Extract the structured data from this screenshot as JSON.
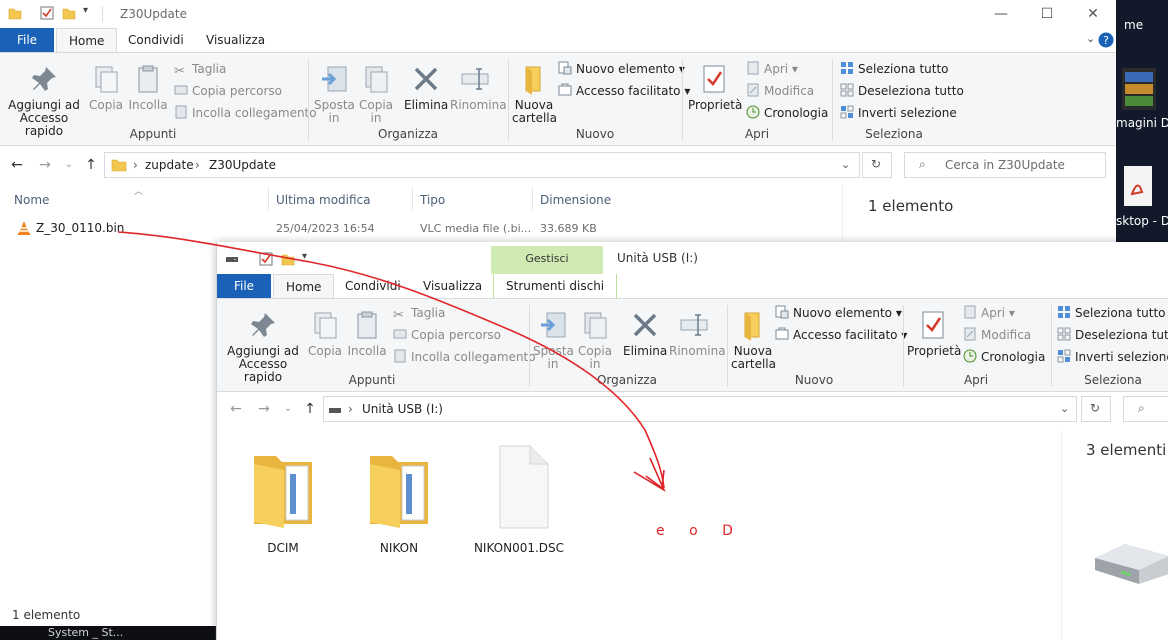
{
  "desktop": {
    "items": [
      {
        "label": "me"
      },
      {
        "label": "magini D"
      },
      {
        "label": "sktop - D"
      }
    ],
    "taskbar_text": "System _ St..."
  },
  "back_window": {
    "title": "Z30Update",
    "tabs": [
      {
        "label": "File"
      },
      {
        "label": "Home"
      },
      {
        "label": "Condividi"
      },
      {
        "label": "Visualizza"
      }
    ],
    "ribbon": {
      "appunti": {
        "pin_label": "Aggiungi ad Accesso rapido",
        "copy_label": "Copia",
        "paste_label": "Incolla",
        "cut_label": "Taglia",
        "copy_path_label": "Copia percorso",
        "paste_link_label": "Incolla collegamento",
        "group_label": "Appunti"
      },
      "organizza": {
        "move_label": "Sposta in",
        "copyto_label": "Copia in",
        "delete_label": "Elimina",
        "rename_label": "Rinomina",
        "group_label": "Organizza"
      },
      "nuovo": {
        "new_folder_label": "Nuova cartella",
        "new_item_label": "Nuovo elemento",
        "easy_access_label": "Accesso facilitato",
        "group_label": "Nuovo"
      },
      "apri": {
        "properties_label": "Proprietà",
        "open_label": "Apri",
        "edit_label": "Modifica",
        "history_label": "Cronologia",
        "group_label": "Apri"
      },
      "seleziona": {
        "select_all_label": "Seleziona tutto",
        "select_none_label": "Deseleziona tutto",
        "invert_label": "Inverti selezione",
        "group_label": "Seleziona"
      }
    },
    "address": {
      "crumbs": [
        "zupdate",
        "Z30Update"
      ],
      "search_placeholder": "Cerca in Z30Update"
    },
    "columns": {
      "name": "Nome",
      "modified": "Ultima modifica",
      "type": "Tipo",
      "size": "Dimensione"
    },
    "files": [
      {
        "name": "Z_30_0110.bin",
        "modified": "25/04/2023 16:54",
        "type": "VLC media file (.bi...",
        "size": "33.689 KB"
      }
    ],
    "details_count": "1 elemento",
    "status": "1 elemento"
  },
  "front_window": {
    "title": "Unità USB (I:)",
    "context_tab_group": "Gestisci",
    "tabs": [
      {
        "label": "File"
      },
      {
        "label": "Home"
      },
      {
        "label": "Condividi"
      },
      {
        "label": "Visualizza"
      },
      {
        "label": "Strumenti dischi"
      }
    ],
    "ribbon": {
      "appunti": {
        "pin_label": "Aggiungi ad Accesso rapido",
        "copy_label": "Copia",
        "paste_label": "Incolla",
        "cut_label": "Taglia",
        "copy_path_label": "Copia percorso",
        "paste_link_label": "Incolla collegamento",
        "group_label": "Appunti"
      },
      "organizza": {
        "move_label": "Sposta in",
        "copyto_label": "Copia in",
        "delete_label": "Elimina",
        "rename_label": "Rinomina",
        "group_label": "Organizza"
      },
      "nuovo": {
        "new_folder_label": "Nuova cartella",
        "new_item_label": "Nuovo elemento",
        "easy_access_label": "Accesso facilitato",
        "group_label": "Nuovo"
      },
      "apri": {
        "properties_label": "Proprietà",
        "open_label": "Apri",
        "edit_label": "Modifica",
        "history_label": "Cronologia",
        "group_label": "Apri"
      },
      "seleziona": {
        "select_all_label": "Seleziona tutto",
        "select_none_label": "Deseleziona tutto",
        "invert_label": "Inverti selezione",
        "group_label": "Seleziona"
      }
    },
    "address": {
      "crumbs": [
        "Unità USB (I:)"
      ]
    },
    "items": [
      {
        "name": "DCIM"
      },
      {
        "name": "NIKON"
      },
      {
        "name": "NIKON001.DSC"
      }
    ],
    "details_count": "3 elementi"
  },
  "annotation": {
    "handwritten_text": "e o D",
    "color": "#e0262a"
  }
}
